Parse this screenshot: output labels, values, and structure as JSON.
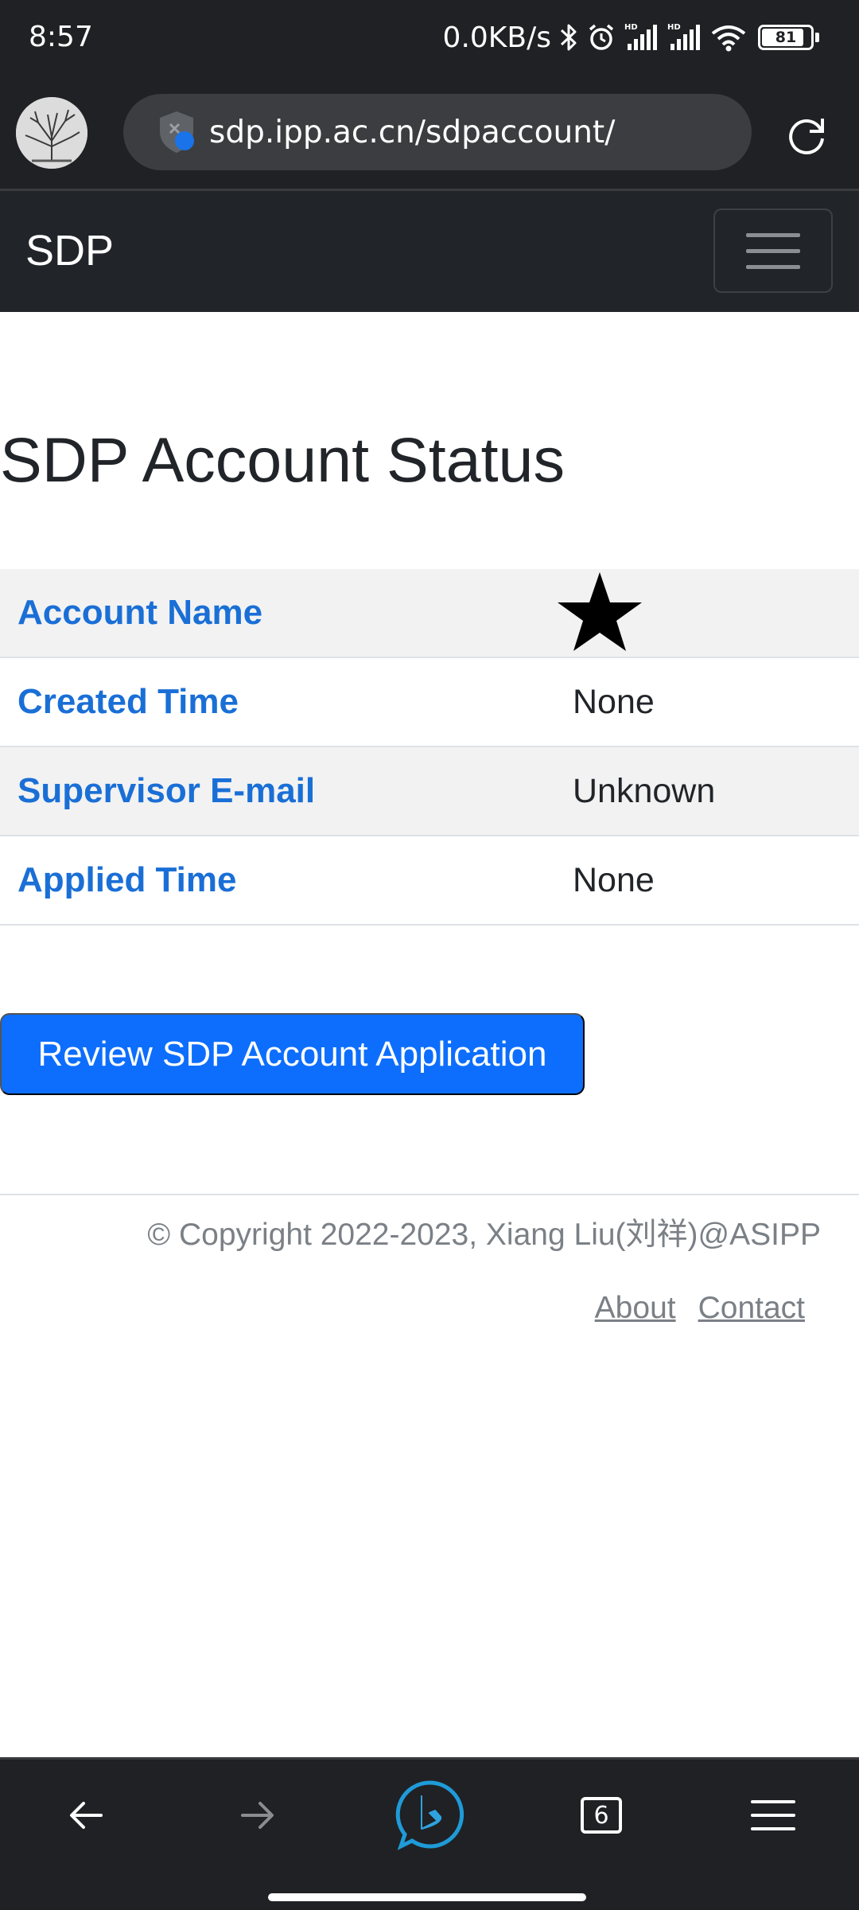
{
  "status_bar": {
    "time": "8:57",
    "net_speed": "0.0KB/s",
    "battery": "81",
    "icons": [
      "bluetooth-icon",
      "alarm-icon",
      "signal-hd-icon",
      "signal-hd-icon",
      "wifi-icon",
      "battery-icon"
    ]
  },
  "browser": {
    "url": "sdp.ipp.ac.cn/sdpaccount/",
    "tab_count": "6",
    "accent": "#1e9bd8"
  },
  "navbar": {
    "brand": "SDP"
  },
  "main": {
    "title": "SDP Account Status",
    "rows": [
      {
        "label": "Account Name",
        "value": ""
      },
      {
        "label": "Created Time",
        "value": "None"
      },
      {
        "label": "Supervisor E-mail",
        "value": "Unknown"
      },
      {
        "label": "Applied Time",
        "value": "None"
      }
    ],
    "review_button": "Review SDP Account Application"
  },
  "footer": {
    "copyright": "© Copyright 2022-2023, Xiang Liu(刘祥)@ASIPP",
    "links": [
      "About",
      "Contact"
    ]
  },
  "colors": {
    "link_blue": "#1a6fd6",
    "primary": "#0d6efd",
    "navbar_bg": "#212529"
  }
}
